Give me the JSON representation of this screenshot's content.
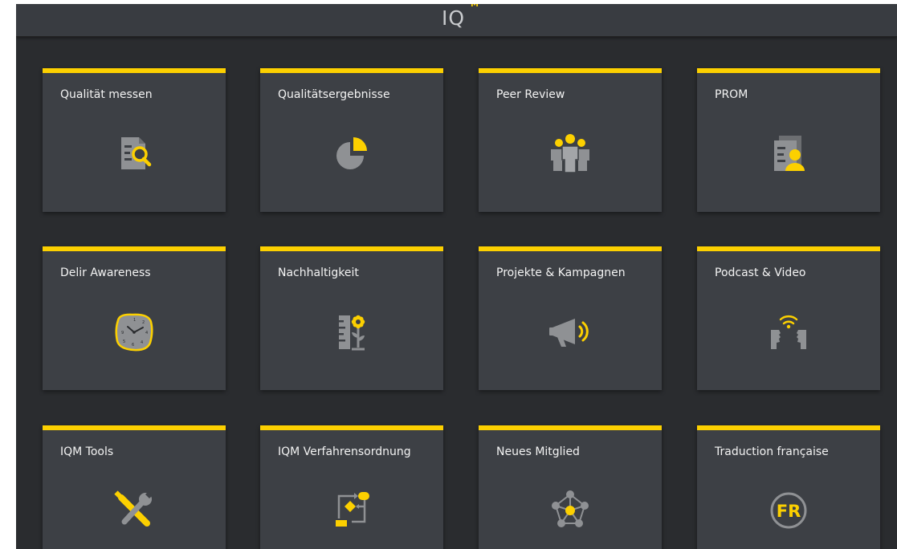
{
  "header": {
    "logo_text": "IQ",
    "logo_sup": "M"
  },
  "tiles": [
    {
      "label": "Qualität messen",
      "icon": "document-search-icon"
    },
    {
      "label": "Qualitätsergebnisse",
      "icon": "pie-chart-icon"
    },
    {
      "label": "Peer Review",
      "icon": "people-group-icon"
    },
    {
      "label": "PROM",
      "icon": "document-person-icon"
    },
    {
      "label": "Delir Awareness",
      "icon": "melting-clock-icon"
    },
    {
      "label": "Nachhaltigkeit",
      "icon": "ruler-flower-icon"
    },
    {
      "label": "Projekte & Kampagnen",
      "icon": "megaphone-icon"
    },
    {
      "label": "Podcast & Video",
      "icon": "speaking-faces-icon"
    },
    {
      "label": "IQM Tools",
      "icon": "wrench-tools-icon"
    },
    {
      "label": "IQM Verfahrensordnung",
      "icon": "process-flow-icon"
    },
    {
      "label": "Neues Mitglied",
      "icon": "network-hub-icon"
    },
    {
      "label": "Traduction française",
      "icon": "fr-badge-icon",
      "icon_text": "FR"
    }
  ],
  "colors": {
    "accent": "#fcd000",
    "tile_bg": "#3d4045",
    "page_bg": "#2a2c2f",
    "icon_gray": "#8f9194",
    "topbar_bg": "#393c41"
  }
}
